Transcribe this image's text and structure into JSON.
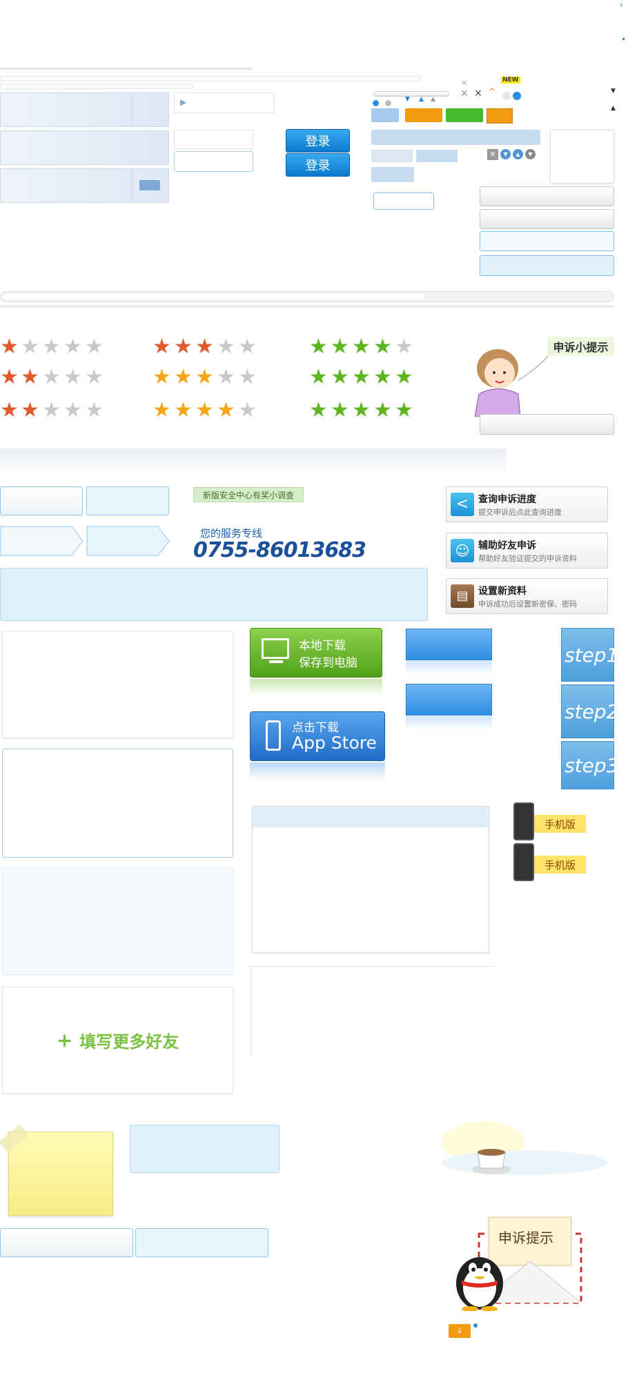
{
  "login": {
    "btn1": "登录",
    "btn2": "登录"
  },
  "badges": {
    "new": "NEW"
  },
  "tip_bubble": {
    "label": "申诉小提示"
  },
  "survey": {
    "label": "新版安全中心有奖小调查"
  },
  "service": {
    "title": "您的服务专线",
    "phone": "0755-86013683"
  },
  "menu": [
    {
      "title": "查询申诉进度",
      "desc": "提交申诉后点此查询进度",
      "icon": "arrow-left-icon"
    },
    {
      "title": "辅助好友申诉",
      "desc": "帮助好友验证提交的申诉资料",
      "icon": "smile-icon"
    },
    {
      "title": "设置新资料",
      "desc": "申诉成功后设置新密保、密码",
      "icon": "clipboard-icon"
    }
  ],
  "download": {
    "local_line1": "本地下载",
    "local_line2": "保存到电脑",
    "app_line1": "点击下载",
    "app_line2": "App Store"
  },
  "steps": [
    "step1",
    "step2",
    "step3"
  ],
  "mobile_tags": [
    "手机版",
    "手机版"
  ],
  "add_friends": {
    "plus": "+",
    "label": "填写更多好友"
  },
  "envelope": {
    "label": "申诉提示"
  },
  "colors": {
    "orange": "#f39a11",
    "green": "#45b92c",
    "blue": "#1c87d9",
    "light": "#dff0fd"
  }
}
